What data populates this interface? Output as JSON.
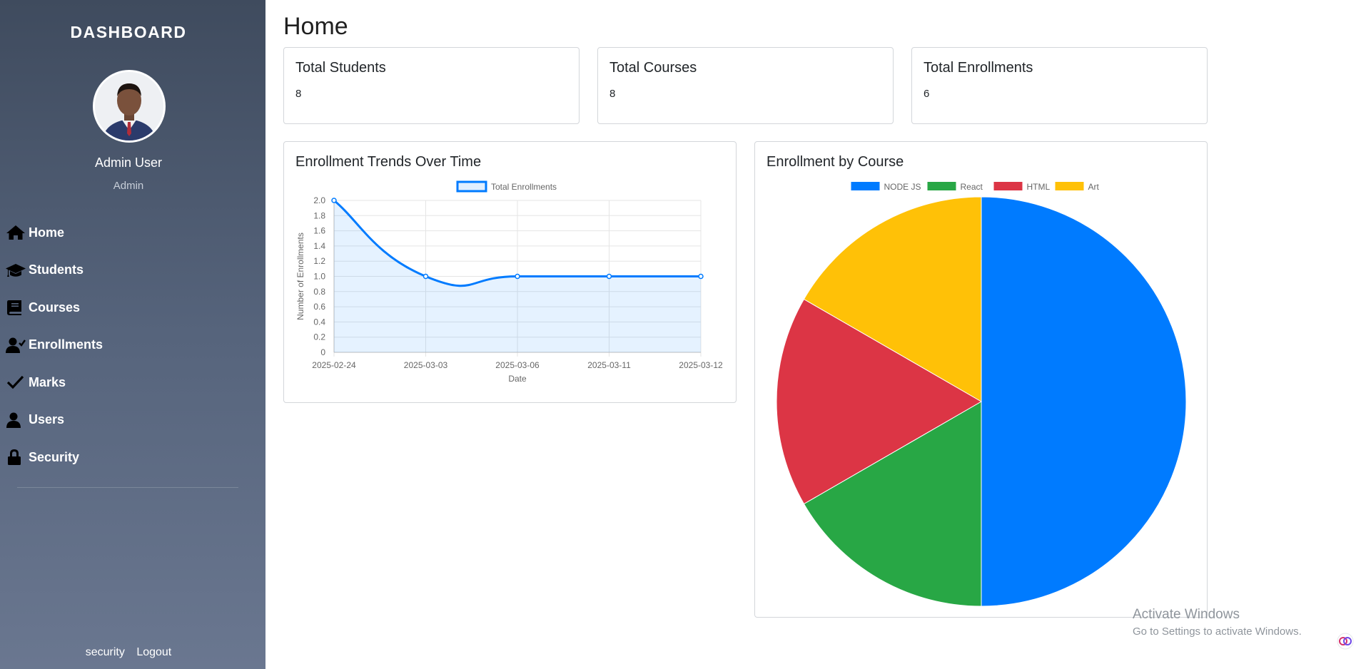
{
  "sidebar": {
    "brand": "DASHBOARD",
    "user_name": "Admin User",
    "user_role": "Admin",
    "nav": [
      {
        "label": "Home",
        "icon": "home-icon"
      },
      {
        "label": "Students",
        "icon": "graduation-cap-icon"
      },
      {
        "label": "Courses",
        "icon": "book-icon"
      },
      {
        "label": "Enrollments",
        "icon": "user-check-icon"
      },
      {
        "label": "Marks",
        "icon": "check-icon"
      },
      {
        "label": "Users",
        "icon": "user-icon"
      },
      {
        "label": "Security",
        "icon": "lock-icon"
      }
    ],
    "footer": {
      "security": "security",
      "logout": "Logout"
    }
  },
  "main": {
    "title": "Home",
    "stats": [
      {
        "title": "Total Students",
        "value": "8"
      },
      {
        "title": "Total Courses",
        "value": "8"
      },
      {
        "title": "Total Enrollments",
        "value": "6"
      }
    ]
  },
  "charts": {
    "line_title": "Enrollment Trends Over Time",
    "pie_title": "Enrollment by Course"
  },
  "chart_data": [
    {
      "type": "line",
      "title": "Enrollment Trends Over Time",
      "xlabel": "Date",
      "ylabel": "Number of Enrollments",
      "categories": [
        "2025-02-24",
        "2025-03-03",
        "2025-03-06",
        "2025-03-11",
        "2025-03-12"
      ],
      "series": [
        {
          "name": "Total Enrollments",
          "values": [
            2,
            1,
            1,
            1,
            1
          ],
          "color": "#007bff"
        }
      ],
      "ylim": [
        0,
        2
      ],
      "yticks": [
        "0",
        "0.2",
        "0.4",
        "0.6",
        "0.8",
        "1.0",
        "1.2",
        "1.4",
        "1.6",
        "1.8",
        "2.0"
      ],
      "grid": true,
      "legend": "top"
    },
    {
      "type": "pie",
      "title": "Enrollment by Course",
      "categories": [
        "NODE JS",
        "React",
        "HTML",
        "Art"
      ],
      "values": [
        3,
        1,
        1,
        1
      ],
      "colors": [
        "#007bff",
        "#28a745",
        "#dc3545",
        "#ffc107"
      ],
      "legend": "top"
    }
  ],
  "system": {
    "activate_title": "Activate Windows",
    "activate_sub": "Go to Settings to activate Windows."
  }
}
